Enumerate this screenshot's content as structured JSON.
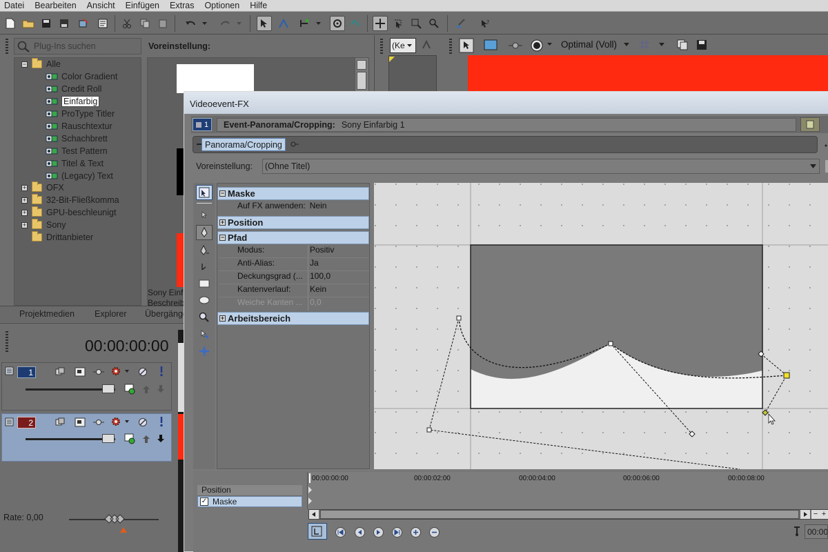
{
  "menu": [
    "Datei",
    "Bearbeiten",
    "Ansicht",
    "Einfügen",
    "Extras",
    "Optionen",
    "Hilfe"
  ],
  "plugins": {
    "search_placeholder": "Plug-Ins suchen",
    "root": "Alle",
    "items": [
      "Color Gradient",
      "Credit Roll",
      "Einfarbig",
      "ProType Titler",
      "Rauschtextur",
      "Schachbrett",
      "Test Pattern",
      "Titel & Text",
      "(Legacy) Text"
    ],
    "selected": "Einfarbig",
    "folders": [
      "OFX",
      "32-Bit-Fließkomma",
      "GPU-beschleunigt",
      "Sony",
      "Drittanbieter"
    ]
  },
  "preset_panel": {
    "label": "Voreinstellung:",
    "caption1": "Sony Einf",
    "caption2": "Beschreib"
  },
  "bottom_tabs": [
    "Projektmedien",
    "Explorer",
    "Übergänge"
  ],
  "timecode": "00:00:00:00",
  "tracks": [
    {
      "number": "1"
    },
    {
      "number": "2"
    }
  ],
  "rate": "Rate: 0,00",
  "preview_toolbar": {
    "dropdown": "(Ke",
    "quality": "Optimal (Voll)"
  },
  "dialog": {
    "title": "Videoevent-FX",
    "track_number": "1",
    "event_label": "Event-Panorama/Cropping:",
    "event_name": "Sony Einfarbig 1",
    "chain_label": "Panorama/Cropping",
    "preset_label": "Voreinstellung:",
    "preset_value": "(Ohne Titel)"
  },
  "props": {
    "maske": {
      "title": "Maske",
      "rows": [
        {
          "k": "Auf FX anwenden:",
          "v": "Nein"
        }
      ]
    },
    "position": {
      "title": "Position"
    },
    "pfad": {
      "title": "Pfad",
      "rows": [
        {
          "k": "Modus:",
          "v": "Positiv"
        },
        {
          "k": "Anti-Alias:",
          "v": "Ja"
        },
        {
          "k": "Deckungsgrad (...",
          "v": "100,0"
        },
        {
          "k": "Kantenverlauf:",
          "v": "Kein"
        },
        {
          "k": "Weiche Kanten ...",
          "v": "0,0"
        }
      ]
    },
    "arbeitsbereich": {
      "title": "Arbeitsbereich"
    }
  },
  "keyframe_tracks": [
    "Position",
    "Maske"
  ],
  "ruler": [
    "00:00:00:00",
    "00:00:02:00",
    "00:00:04:00",
    "00:00:06:00",
    "00:00:08:00"
  ],
  "timeline_readout": "00:00",
  "colors": {
    "preview_red": "#ff2a10",
    "selection_blue": "#bcd1e8"
  }
}
